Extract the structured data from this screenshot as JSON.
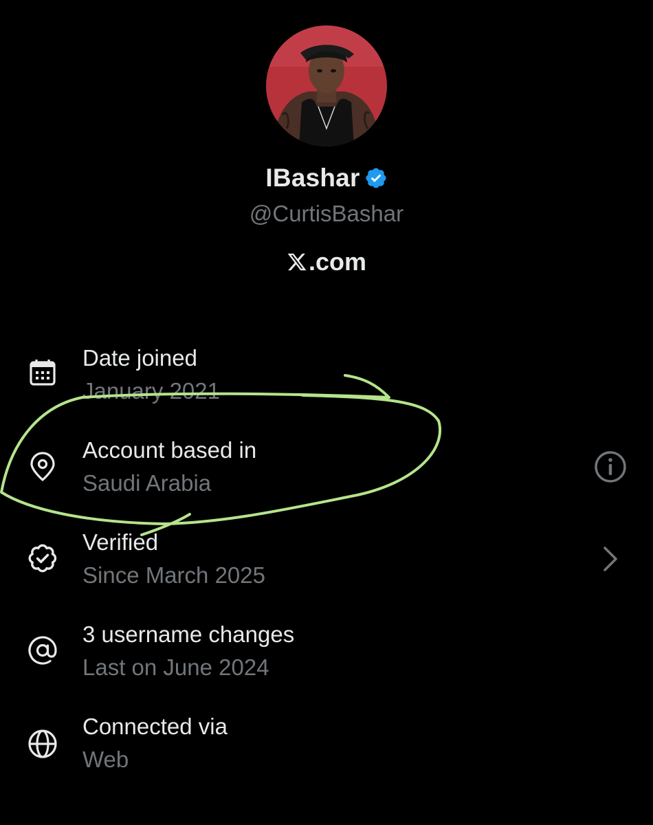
{
  "profile": {
    "display_name": "IBashar",
    "handle": "@CurtisBashar",
    "site_label": ".com",
    "avatar_icon": "profile-photo",
    "verified_icon": "verified-badge-icon",
    "verified_color": "#1d9bf0"
  },
  "details": [
    {
      "icon": "calendar-icon",
      "label": "Date joined",
      "value": "January 2021"
    },
    {
      "icon": "location-pin-icon",
      "label": "Account based in",
      "value": "Saudi Arabia",
      "trailing_icon": "info-icon"
    },
    {
      "icon": "verified-outline-icon",
      "label": "Verified",
      "value": "Since March 2025",
      "trailing_icon": "chevron-right-icon"
    },
    {
      "icon": "at-sign-icon",
      "label": "3 username changes",
      "value": "Last on June 2024"
    },
    {
      "icon": "globe-icon",
      "label": "Connected via",
      "value": "Web"
    }
  ],
  "colors": {
    "background": "#000000",
    "primary_text": "#e7e9ea",
    "secondary_text": "#71767b",
    "annotation_stroke": "#b5e48c"
  }
}
